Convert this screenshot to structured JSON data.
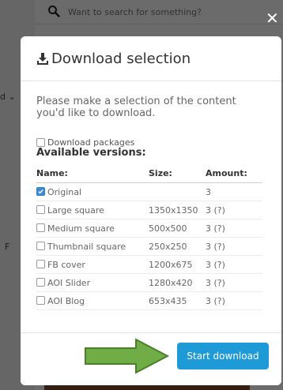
{
  "background": {
    "search_placeholder": "Want to search for something?"
  },
  "modal": {
    "title": "Download selection",
    "intro": "Please make a selection of the content you'd like to download.",
    "packages_label": "Download packages",
    "versions_title": "Available versions:",
    "columns": {
      "name": "Name:",
      "size": "Size:",
      "amount": "Amount:"
    },
    "rows": [
      {
        "name": "Original",
        "size": "",
        "amount": "3",
        "checked": true
      },
      {
        "name": "Large square",
        "size": "1350x1350",
        "amount": "3 (?)",
        "checked": false
      },
      {
        "name": "Medium square",
        "size": "500x500",
        "amount": "3 (?)",
        "checked": false
      },
      {
        "name": "Thumbnail square",
        "size": "250x250",
        "amount": "3 (?)",
        "checked": false
      },
      {
        "name": "FB cover",
        "size": "1200x675",
        "amount": "3 (?)",
        "checked": false
      },
      {
        "name": "AOI Slider",
        "size": "1280x420",
        "amount": "3 (?)",
        "checked": false
      },
      {
        "name": "AOI Blog",
        "size": "653x435",
        "amount": "3 (?)",
        "checked": false
      }
    ],
    "start_button": "Start download"
  },
  "icons": {
    "close": "close-icon",
    "download": "download-icon",
    "search": "search-icon",
    "arrow": "green-arrow-icon"
  },
  "colors": {
    "button": "#1e9bd7",
    "arrow_fill": "#70ad47",
    "arrow_stroke": "#4a7f2c",
    "checkbox_checked": "#3b8bd6"
  }
}
